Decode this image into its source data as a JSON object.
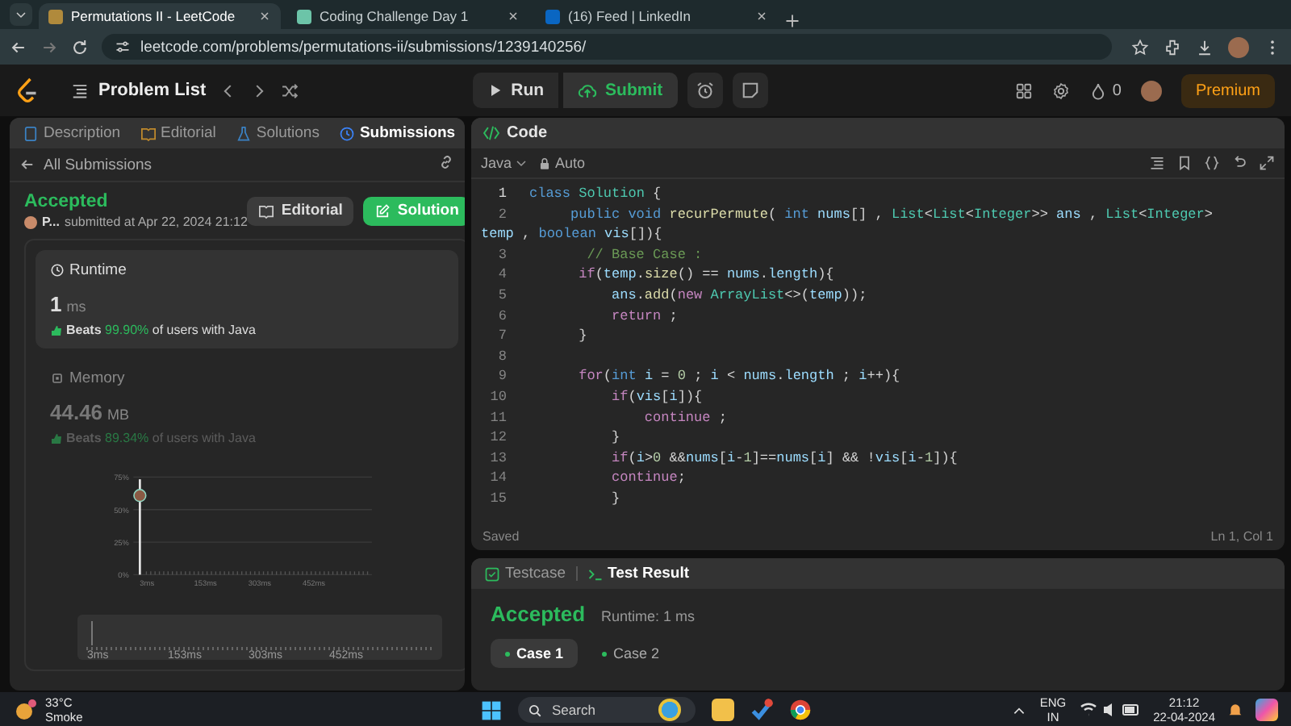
{
  "browser": {
    "tabs": [
      {
        "title": "Permutations II - LeetCode",
        "selected": true
      },
      {
        "title": "Coding Challenge Day 1",
        "selected": false
      },
      {
        "title": "(16) Feed | LinkedIn",
        "selected": false
      }
    ],
    "url": "leetcode.com/problems/permutations-ii/submissions/1239140256/"
  },
  "nav": {
    "problem_list": "Problem List",
    "run": "Run",
    "submit": "Submit",
    "streak": "0",
    "premium": "Premium"
  },
  "left_panel": {
    "tabs": [
      {
        "label": "Description",
        "selected": false
      },
      {
        "label": "Editorial",
        "selected": false
      },
      {
        "label": "Solutions",
        "selected": false
      },
      {
        "label": "Submissions",
        "selected": true
      }
    ],
    "back_link": "All Submissions",
    "status": "Accepted",
    "user": "P...",
    "submitted": "submitted at Apr 22, 2024 21:12",
    "buttons": [
      {
        "label": "Editorial",
        "kind": "secondary"
      },
      {
        "label": "Solution",
        "kind": "primary"
      }
    ],
    "metrics": [
      {
        "kind": "runtime",
        "title": "Runtime",
        "value": "1",
        "unit": "ms",
        "beats_label": "Beats",
        "beats_pct": "99.90%",
        "beats_suffix": "of users with Java",
        "selected": true
      },
      {
        "kind": "memory",
        "title": "Memory",
        "value": "44.46",
        "unit": "MB",
        "beats_label": "Beats",
        "beats_pct": "89.34%",
        "beats_suffix": "of users with Java",
        "selected": false
      }
    ],
    "distribution": {
      "y_ticks": [
        "75%",
        "50%",
        "25%",
        "0%"
      ],
      "x_ticks": [
        "3ms",
        "153ms",
        "303ms",
        "452ms"
      ],
      "overview_ticks": [
        "3ms",
        "153ms",
        "303ms",
        "452ms"
      ]
    }
  },
  "editor": {
    "title": "Code",
    "language": "Java",
    "mode": "Auto",
    "status": "Saved",
    "cursor": "Ln 1, Col 1",
    "lines": [
      {
        "n": "1",
        "tokens": [
          {
            "text": "class ",
            "kind": "kw"
          },
          {
            "text": "Solution",
            "kind": "type"
          },
          {
            "text": " {",
            "kind": "p"
          }
        ]
      },
      {
        "n": "2",
        "tokens": [
          {
            "text": "     public void ",
            "kind": "kw"
          },
          {
            "text": "recurPermute",
            "kind": "fn"
          },
          {
            "text": "( ",
            "kind": "p"
          },
          {
            "text": "int ",
            "kind": "kw"
          },
          {
            "text": "nums",
            "kind": "id"
          },
          {
            "text": "[] , ",
            "kind": "p"
          },
          {
            "text": "List",
            "kind": "type"
          },
          {
            "text": "<",
            "kind": "p"
          },
          {
            "text": "List",
            "kind": "type"
          },
          {
            "text": "<",
            "kind": "p"
          },
          {
            "text": "Integer",
            "kind": "type"
          },
          {
            "text": ">> ",
            "kind": "p"
          },
          {
            "text": "ans",
            "kind": "id"
          },
          {
            "text": " , ",
            "kind": "p"
          },
          {
            "text": "List",
            "kind": "type"
          },
          {
            "text": "<",
            "kind": "p"
          },
          {
            "text": "Integer",
            "kind": "type"
          },
          {
            "text": ">",
            "kind": "p"
          }
        ],
        "wrap": [
          {
            "text": "temp",
            "kind": "id"
          },
          {
            "text": " , ",
            "kind": "p"
          },
          {
            "text": "boolean ",
            "kind": "kw"
          },
          {
            "text": "vis",
            "kind": "id"
          },
          {
            "text": "[]){",
            "kind": "p"
          }
        ]
      },
      {
        "n": "3",
        "tokens": [
          {
            "text": "       // Base Case :",
            "kind": "cm"
          }
        ]
      },
      {
        "n": "4",
        "tokens": [
          {
            "text": "      if",
            "kind": "ctrl"
          },
          {
            "text": "(",
            "kind": "p"
          },
          {
            "text": "temp",
            "kind": "id"
          },
          {
            "text": ".",
            "kind": "p"
          },
          {
            "text": "size",
            "kind": "fn"
          },
          {
            "text": "() == ",
            "kind": "p"
          },
          {
            "text": "nums",
            "kind": "id"
          },
          {
            "text": ".",
            "kind": "p"
          },
          {
            "text": "length",
            "kind": "id"
          },
          {
            "text": "){",
            "kind": "p"
          }
        ]
      },
      {
        "n": "5",
        "tokens": [
          {
            "text": "          ans",
            "kind": "id"
          },
          {
            "text": ".",
            "kind": "p"
          },
          {
            "text": "add",
            "kind": "fn"
          },
          {
            "text": "(",
            "kind": "p"
          },
          {
            "text": "new ",
            "kind": "ctrl"
          },
          {
            "text": "ArrayList",
            "kind": "type"
          },
          {
            "text": "<>(",
            "kind": "p"
          },
          {
            "text": "temp",
            "kind": "id"
          },
          {
            "text": "));",
            "kind": "p"
          }
        ]
      },
      {
        "n": "6",
        "tokens": [
          {
            "text": "          return",
            "kind": "ctrl"
          },
          {
            "text": " ;",
            "kind": "p"
          }
        ]
      },
      {
        "n": "7",
        "tokens": [
          {
            "text": "      }",
            "kind": "p"
          }
        ]
      },
      {
        "n": "8"
      },
      {
        "n": "9",
        "tokens": [
          {
            "text": "      for",
            "kind": "ctrl"
          },
          {
            "text": "(",
            "kind": "p"
          },
          {
            "text": "int ",
            "kind": "kw"
          },
          {
            "text": "i",
            "kind": "id"
          },
          {
            "text": " = ",
            "kind": "p"
          },
          {
            "text": "0",
            "kind": "num"
          },
          {
            "text": " ; ",
            "kind": "p"
          },
          {
            "text": "i",
            "kind": "id"
          },
          {
            "text": " < ",
            "kind": "p"
          },
          {
            "text": "nums",
            "kind": "id"
          },
          {
            "text": ".",
            "kind": "p"
          },
          {
            "text": "length",
            "kind": "id"
          },
          {
            "text": " ; ",
            "kind": "p"
          },
          {
            "text": "i",
            "kind": "id"
          },
          {
            "text": "++){",
            "kind": "p"
          }
        ]
      },
      {
        "n": "10",
        "tokens": [
          {
            "text": "          if",
            "kind": "ctrl"
          },
          {
            "text": "(",
            "kind": "p"
          },
          {
            "text": "vis",
            "kind": "id"
          },
          {
            "text": "[",
            "kind": "p"
          },
          {
            "text": "i",
            "kind": "id"
          },
          {
            "text": "]){",
            "kind": "p"
          }
        ]
      },
      {
        "n": "11",
        "tokens": [
          {
            "text": "              continue",
            "kind": "ctrl"
          },
          {
            "text": " ;",
            "kind": "p"
          }
        ]
      },
      {
        "n": "12",
        "tokens": [
          {
            "text": "          }",
            "kind": "p"
          }
        ]
      },
      {
        "n": "13",
        "tokens": [
          {
            "text": "          if",
            "kind": "ctrl"
          },
          {
            "text": "(",
            "kind": "p"
          },
          {
            "text": "i",
            "kind": "id"
          },
          {
            "text": ">",
            "kind": "p"
          },
          {
            "text": "0",
            "kind": "num"
          },
          {
            "text": " &&",
            "kind": "p"
          },
          {
            "text": "nums",
            "kind": "id"
          },
          {
            "text": "[",
            "kind": "p"
          },
          {
            "text": "i",
            "kind": "id"
          },
          {
            "text": "-",
            "kind": "p"
          },
          {
            "text": "1",
            "kind": "num"
          },
          {
            "text": "]==",
            "kind": "p"
          },
          {
            "text": "nums",
            "kind": "id"
          },
          {
            "text": "[",
            "kind": "p"
          },
          {
            "text": "i",
            "kind": "id"
          },
          {
            "text": "] && !",
            "kind": "p"
          },
          {
            "text": "vis",
            "kind": "id"
          },
          {
            "text": "[",
            "kind": "p"
          },
          {
            "text": "i",
            "kind": "id"
          },
          {
            "text": "-",
            "kind": "p"
          },
          {
            "text": "1",
            "kind": "num"
          },
          {
            "text": "]){",
            "kind": "p"
          }
        ]
      },
      {
        "n": "14",
        "tokens": [
          {
            "text": "          continue",
            "kind": "ctrl"
          },
          {
            "text": ";",
            "kind": "p"
          }
        ]
      },
      {
        "n": "15",
        "tokens": [
          {
            "text": "          }",
            "kind": "p"
          }
        ]
      }
    ]
  },
  "test_panel": {
    "tabs": [
      {
        "label": "Testcase",
        "selected": false
      },
      {
        "label": "Test Result",
        "selected": true
      }
    ],
    "status": "Accepted",
    "runtime": "Runtime: 1 ms",
    "cases": [
      {
        "label": "Case 1",
        "selected": true
      },
      {
        "label": "Case 2",
        "selected": false
      }
    ]
  },
  "taskbar": {
    "temp": "33°C",
    "condition": "Smoke",
    "search": {
      "placeholder": "Search"
    },
    "lang": "ENG",
    "region": "IN",
    "time": "21:12",
    "date": "22-04-2024"
  }
}
